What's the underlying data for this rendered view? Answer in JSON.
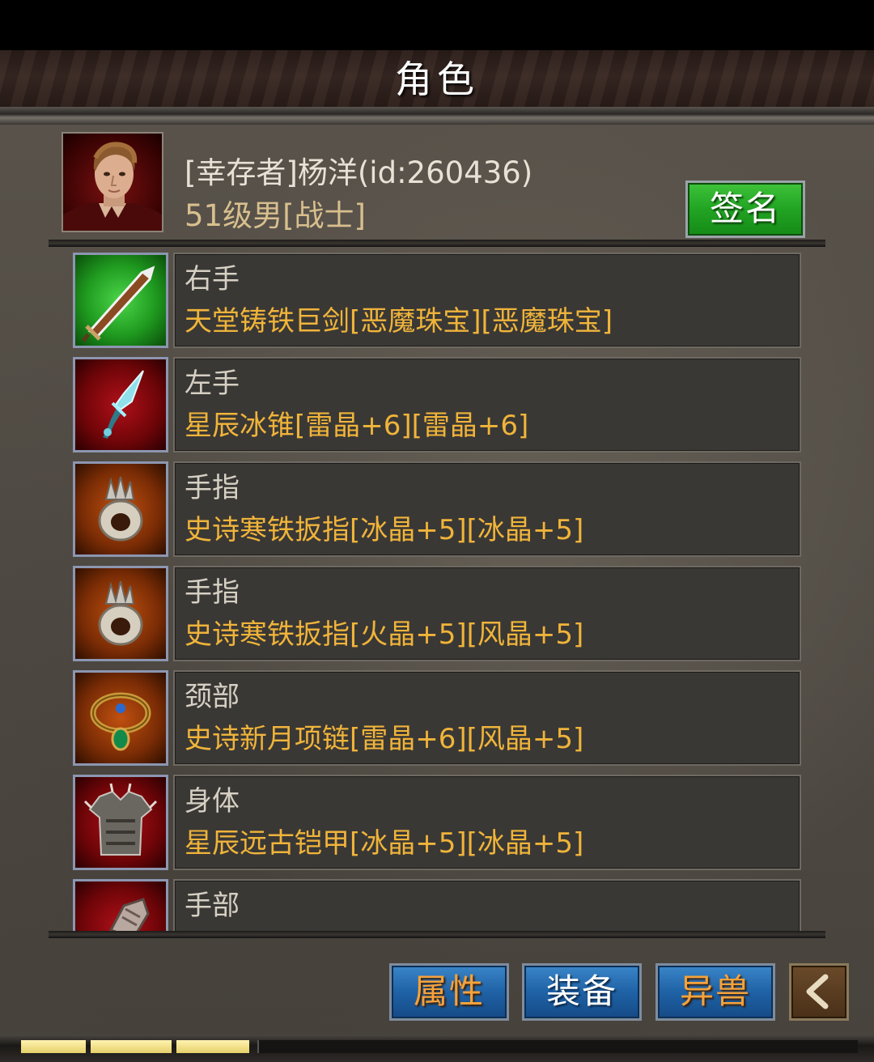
{
  "header": {
    "title": "角色"
  },
  "character": {
    "name": "[幸存者]杨洋(id:260436)",
    "level_line": "51级男[战士]",
    "sign_label": "签名"
  },
  "equipment": [
    {
      "slot": "右手",
      "item": "天堂铸铁巨剑[恶魔珠宝][恶魔珠宝]",
      "icon": "sword-icon",
      "frame": "green"
    },
    {
      "slot": "左手",
      "item": "星辰冰锥[雷晶+6][雷晶+6]",
      "icon": "ice-dagger-icon",
      "frame": "red"
    },
    {
      "slot": "手指",
      "item": "史诗寒铁扳指[冰晶+5][冰晶+5]",
      "icon": "spiked-ring-icon",
      "frame": "orange"
    },
    {
      "slot": "手指",
      "item": "史诗寒铁扳指[火晶+5][风晶+5]",
      "icon": "spiked-ring-icon",
      "frame": "orange"
    },
    {
      "slot": "颈部",
      "item": "史诗新月项链[雷晶+6][风晶+5]",
      "icon": "necklace-icon",
      "frame": "orange"
    },
    {
      "slot": "身体",
      "item": "星辰远古铠甲[冰晶+5][冰晶+5]",
      "icon": "armor-icon",
      "frame": "red"
    },
    {
      "slot": "手部",
      "item": "",
      "icon": "gauntlet-icon",
      "frame": "red"
    }
  ],
  "tabs": {
    "attributes": "属性",
    "equipment": "装备",
    "beast": "异兽"
  },
  "colors": {
    "item_name": "#f0b43a",
    "sign_button": "#22a423",
    "tab_button": "#1f62a6"
  },
  "xp_progress": 0.28
}
